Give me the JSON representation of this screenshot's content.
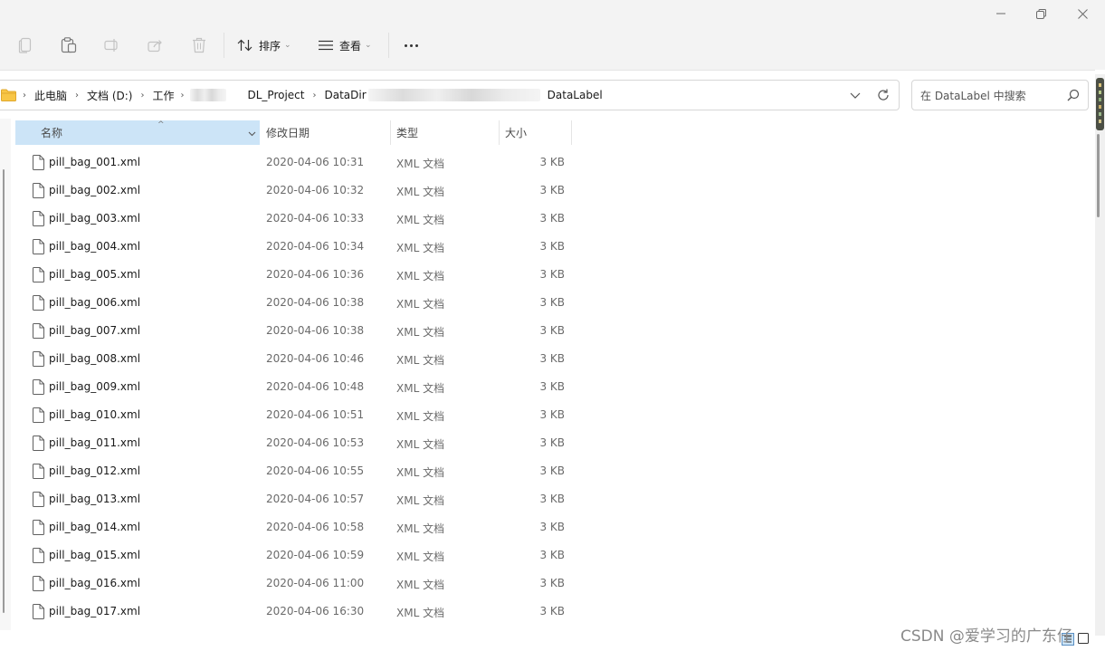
{
  "toolbar": {
    "sort_label": "排序",
    "view_label": "查看"
  },
  "address_bar": {
    "crumbs": [
      "此电脑",
      "文档 (D:)",
      "工作",
      "DL_Project",
      "DataDir",
      "DataLabel"
    ],
    "dir_ellipsis": "ı"
  },
  "search": {
    "placeholder": "在 DataLabel 中搜索"
  },
  "columns": {
    "name": "名称",
    "date": "修改日期",
    "type": "类型",
    "size": "大小"
  },
  "files": [
    {
      "name": "pill_bag_001.xml",
      "date": "2020-04-06 10:31",
      "type": "XML 文档",
      "size": "3 KB"
    },
    {
      "name": "pill_bag_002.xml",
      "date": "2020-04-06 10:32",
      "type": "XML 文档",
      "size": "3 KB"
    },
    {
      "name": "pill_bag_003.xml",
      "date": "2020-04-06 10:33",
      "type": "XML 文档",
      "size": "3 KB"
    },
    {
      "name": "pill_bag_004.xml",
      "date": "2020-04-06 10:34",
      "type": "XML 文档",
      "size": "3 KB"
    },
    {
      "name": "pill_bag_005.xml",
      "date": "2020-04-06 10:36",
      "type": "XML 文档",
      "size": "3 KB"
    },
    {
      "name": "pill_bag_006.xml",
      "date": "2020-04-06 10:38",
      "type": "XML 文档",
      "size": "3 KB"
    },
    {
      "name": "pill_bag_007.xml",
      "date": "2020-04-06 10:38",
      "type": "XML 文档",
      "size": "3 KB"
    },
    {
      "name": "pill_bag_008.xml",
      "date": "2020-04-06 10:46",
      "type": "XML 文档",
      "size": "3 KB"
    },
    {
      "name": "pill_bag_009.xml",
      "date": "2020-04-06 10:48",
      "type": "XML 文档",
      "size": "3 KB"
    },
    {
      "name": "pill_bag_010.xml",
      "date": "2020-04-06 10:51",
      "type": "XML 文档",
      "size": "3 KB"
    },
    {
      "name": "pill_bag_011.xml",
      "date": "2020-04-06 10:53",
      "type": "XML 文档",
      "size": "3 KB"
    },
    {
      "name": "pill_bag_012.xml",
      "date": "2020-04-06 10:55",
      "type": "XML 文档",
      "size": "3 KB"
    },
    {
      "name": "pill_bag_013.xml",
      "date": "2020-04-06 10:57",
      "type": "XML 文档",
      "size": "3 KB"
    },
    {
      "name": "pill_bag_014.xml",
      "date": "2020-04-06 10:58",
      "type": "XML 文档",
      "size": "3 KB"
    },
    {
      "name": "pill_bag_015.xml",
      "date": "2020-04-06 10:59",
      "type": "XML 文档",
      "size": "3 KB"
    },
    {
      "name": "pill_bag_016.xml",
      "date": "2020-04-06 11:00",
      "type": "XML 文档",
      "size": "3 KB"
    },
    {
      "name": "pill_bag_017.xml",
      "date": "2020-04-06 16:30",
      "type": "XML 文档",
      "size": "3 KB"
    }
  ],
  "watermark": "CSDN @爱学习的广东仔",
  "colors": {
    "selected_header": "#cce4f7",
    "toolbar_bg": "#f3f3f3",
    "disabled_icon": "#c3c3c3"
  }
}
